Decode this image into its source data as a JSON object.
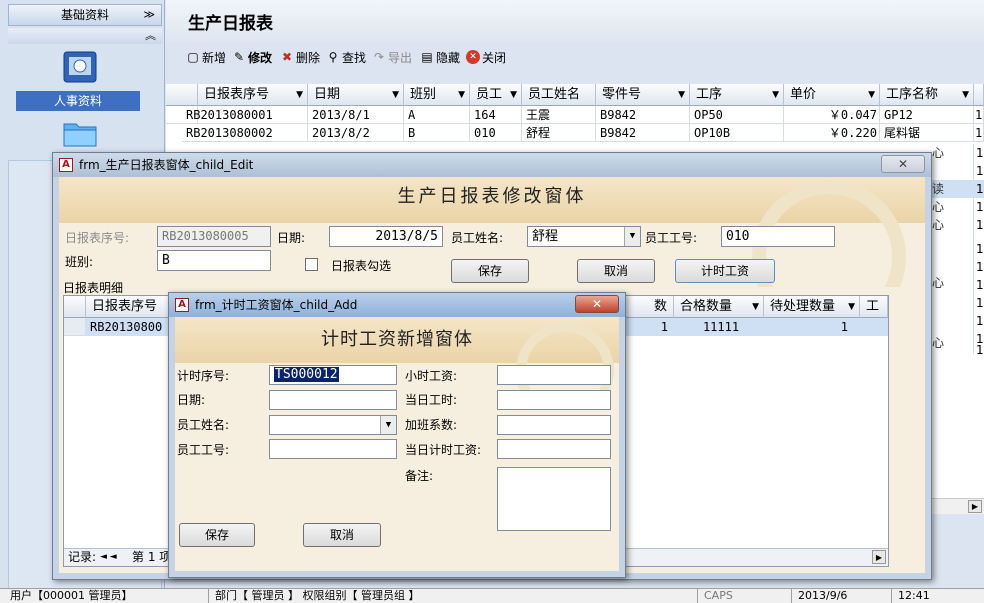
{
  "nav": {
    "category": "基础资料",
    "tool_label": "人事资料"
  },
  "main": {
    "title": "生产日报表",
    "toolbar": [
      {
        "label": "新增",
        "icon": "new-icon",
        "glyph": "▢"
      },
      {
        "label": "修改",
        "icon": "edit-icon",
        "glyph": "✎"
      },
      {
        "label": "删除",
        "icon": "delete-icon",
        "glyph": "✖"
      },
      {
        "label": "查找",
        "icon": "find-icon",
        "glyph": "⚲"
      },
      {
        "label": "导出",
        "icon": "export-icon",
        "glyph": "↷"
      },
      {
        "label": "隐藏",
        "icon": "hide-icon",
        "glyph": "▤"
      },
      {
        "label": "关闭",
        "icon": "close-icon",
        "glyph": "✕"
      }
    ],
    "columns": [
      "日报表序号",
      "日期",
      "班别",
      "员工",
      "员工姓名",
      "零件号",
      "工序",
      "单价",
      "工序名称"
    ],
    "rows": [
      [
        "RB2013080001",
        "2013/8/1",
        "A",
        "164",
        "王震",
        "B9842",
        "OP50",
        "￥0.047",
        "GP12",
        "1"
      ],
      [
        "RB2013080002",
        "2013/8/2",
        "B",
        "010",
        "舒程",
        "B9842",
        "OP10B",
        "￥0.220",
        "尾料锯",
        "1"
      ]
    ],
    "right_col_values": [
      "心",
      "读",
      "心",
      "心",
      "心",
      "心"
    ],
    "right_col_values2": [
      "1",
      "1",
      "1",
      "1",
      "1",
      "1",
      "1",
      "1",
      "1",
      "1",
      "1",
      "1"
    ]
  },
  "edit_window": {
    "title": "frm_生产日报表窗体_child_Edit",
    "heading": "生产日报表修改窗体",
    "fields": {
      "serial_label": "日报表序号:",
      "serial_value": "RB2013080005",
      "date_label": "日期:",
      "date_value": "2013/8/5",
      "name_label": "员工姓名:",
      "name_value": "舒程",
      "empno_label": "员工工号:",
      "empno_value": "010",
      "shift_label": "班别:",
      "shift_value": "B",
      "check_label": "日报表勾选"
    },
    "buttons": {
      "save": "保存",
      "cancel": "取消",
      "timewage": "计时工资"
    },
    "detail_label": "日报表明细",
    "detail_columns": [
      "日报表序号",
      "数",
      "合格数量",
      "待处理数量",
      "工"
    ],
    "detail_row": [
      "RB20130800",
      "1",
      "11111",
      "1"
    ],
    "record_label": "记录:",
    "record_nav": "◄ ◄",
    "record_num": "第 1 项"
  },
  "add_window": {
    "title": "frm_计时工资窗体_child_Add",
    "heading": "计时工资新增窗体",
    "left_labels": [
      "计时序号:",
      "日期:",
      "员工姓名:",
      "员工工号:"
    ],
    "serial_value": "TS000012",
    "right_labels": [
      "小时工资:",
      "当日工时:",
      "加班系数:",
      "当日计时工资:",
      "备注:"
    ],
    "buttons": {
      "save": "保存",
      "cancel": "取消"
    }
  },
  "status": {
    "user": "用户【000001 管理员】",
    "dept": "部门【 管理员 】 权限组别【 管理员组 】",
    "caps": "CAPS",
    "date": "2013/9/6",
    "time": "12:41"
  }
}
